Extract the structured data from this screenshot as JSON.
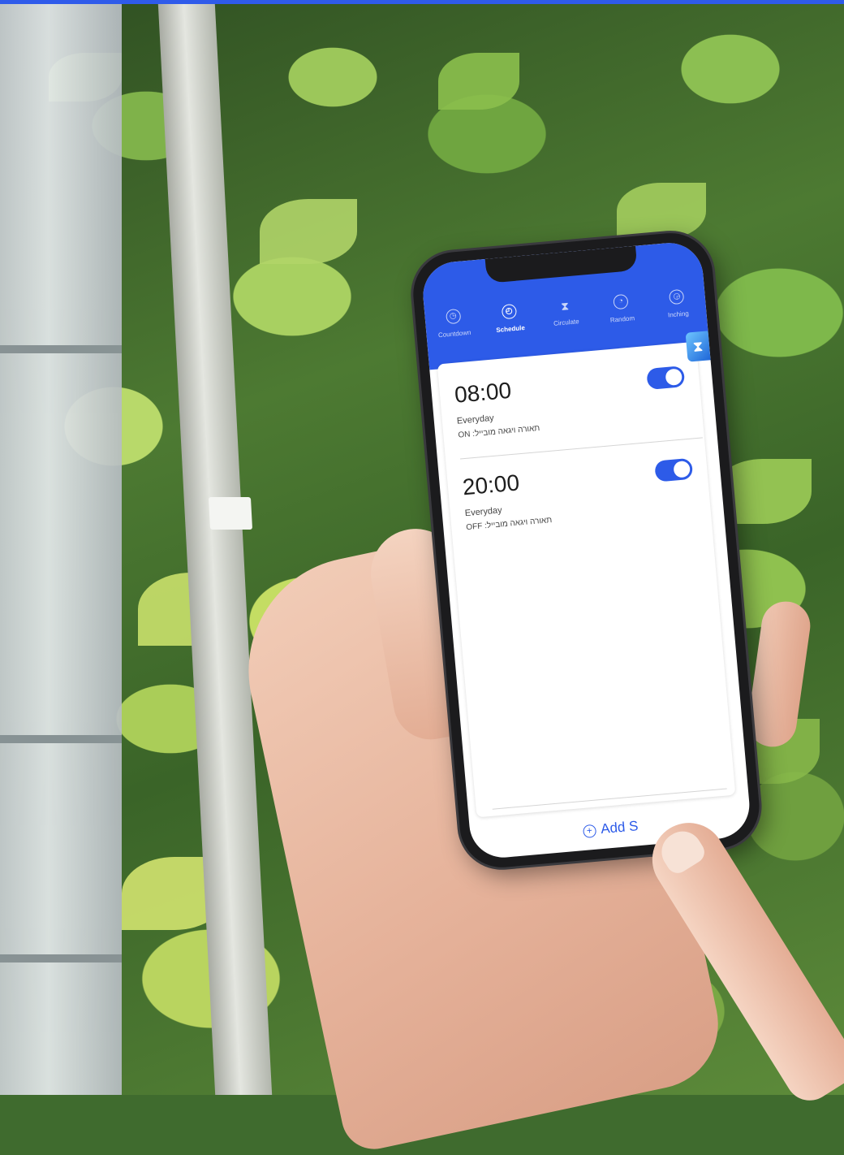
{
  "app": {
    "tabs": [
      {
        "label": "Countdown",
        "icon": "countdown-icon"
      },
      {
        "label": "Schedule",
        "icon": "alarm-clock-icon",
        "active": true
      },
      {
        "label": "Circulate",
        "icon": "hourglass-icon"
      },
      {
        "label": "Random",
        "icon": "stopwatch-icon"
      },
      {
        "label": "Inching",
        "icon": "inching-icon"
      }
    ],
    "schedules": [
      {
        "time": "08:00",
        "repeat": "Everyday",
        "action": "ON :תאורה ויגאה מובייל",
        "enabled": true
      },
      {
        "time": "20:00",
        "repeat": "Everyday",
        "action": "OFF :תאורה ויגאה מובייל",
        "enabled": true
      }
    ],
    "add_button_label": "Add S"
  },
  "colors": {
    "accent": "#2d5be8",
    "top_bar": "#2f5bea"
  }
}
